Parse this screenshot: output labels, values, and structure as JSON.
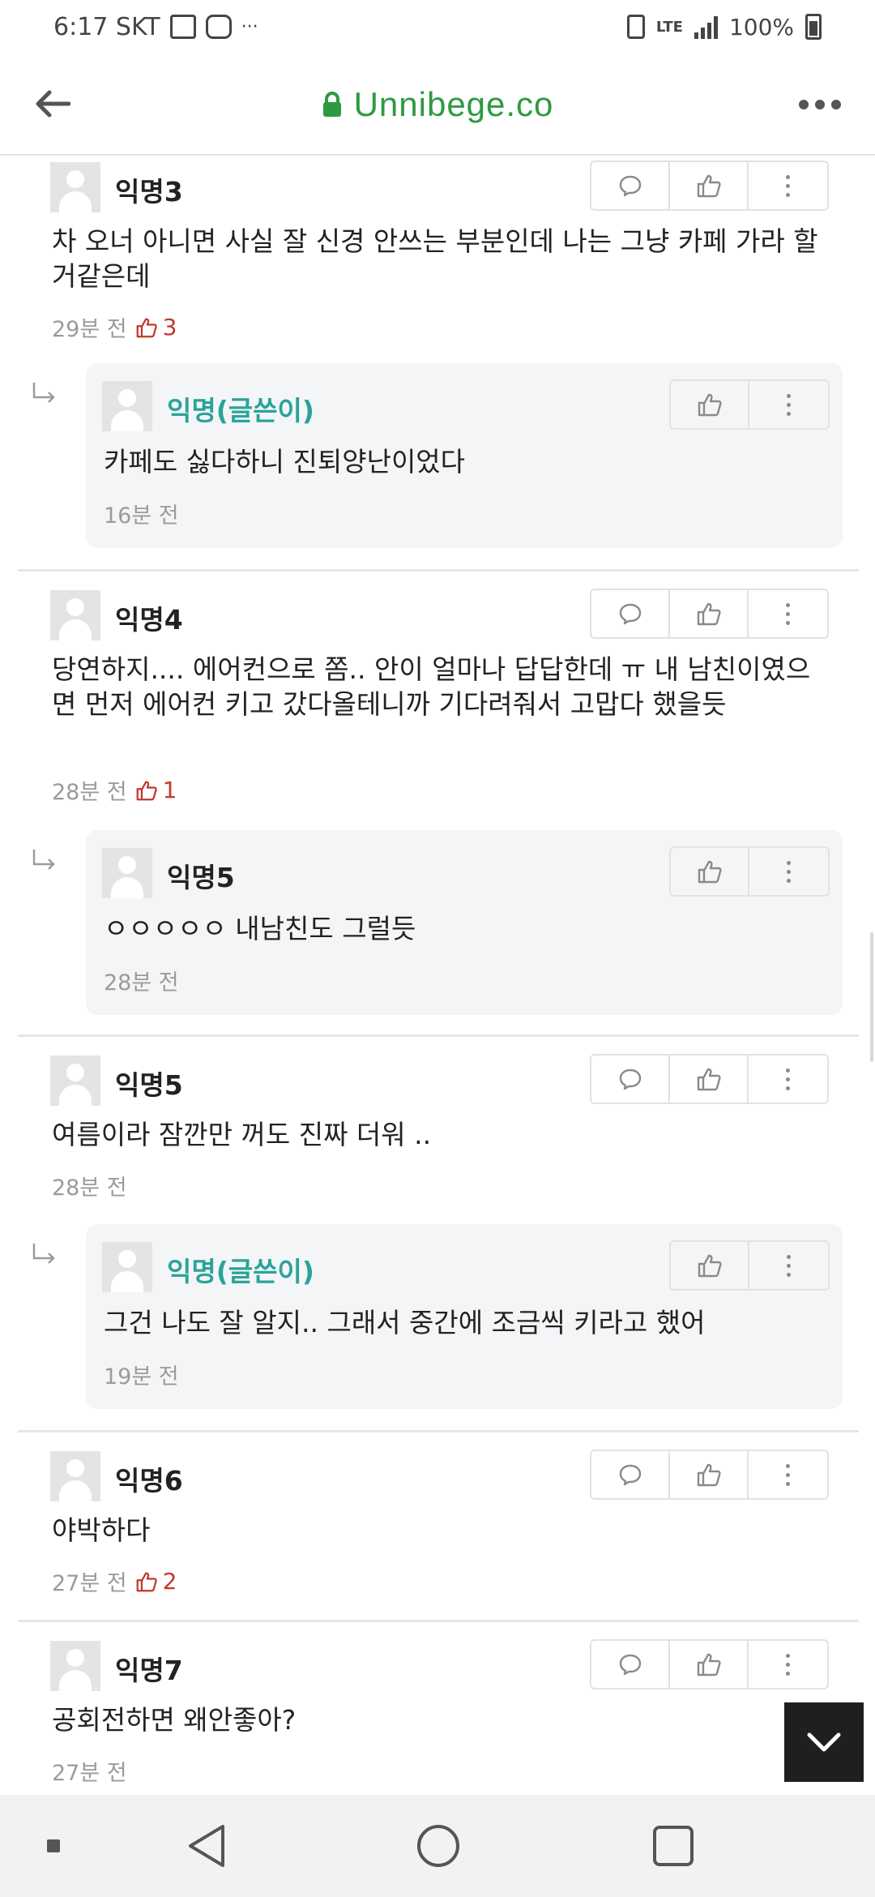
{
  "status_bar": {
    "time_carrier": "6:17 SKT",
    "more_indicator": "···",
    "lte": "LTE",
    "battery": "100%"
  },
  "browser": {
    "url": "Unnibege.co",
    "back_icon": "arrow-left-icon",
    "lock_icon": "lock-icon",
    "menu_icon": "more-horizontal-icon"
  },
  "comments": [
    {
      "nick": "익명3",
      "text": "차 오너 아니면 사실 잘 신경 안쓰는 부분인데 나는 그냥 카페 가라 할거같은데",
      "time": "29분 전",
      "likes": "3",
      "replies": [
        {
          "nick": "익명(글쓴이)",
          "text": "카페도 싫다하니 진퇴양난이었다",
          "time": "16분 전"
        }
      ]
    },
    {
      "nick": "익명4",
      "text": "당연하지.... 에어컨으로 쫌.. 안이 얼마나 답답한데 ㅠ 내 남친이였으면 먼저 에어컨 키고 갔다올테니까 기다려줘서 고맙다 했을듯",
      "time": "28분 전",
      "likes": "1",
      "replies": [
        {
          "nick": "익명5",
          "text": "ㅇㅇㅇㅇㅇ 내남친도 그럴듯",
          "time": "28분 전"
        }
      ]
    },
    {
      "nick": "익명5",
      "text": "여름이라 잠깐만 꺼도 진짜 더워 ..",
      "time": "28분 전",
      "likes": "",
      "replies": [
        {
          "nick": "익명(글쓴이)",
          "text": "그건 나도 잘 알지.. 그래서 중간에 조금씩 키라고 했어",
          "time": "19분 전"
        }
      ]
    },
    {
      "nick": "익명6",
      "text": "야박하다",
      "time": "27분 전",
      "likes": "2",
      "replies": []
    },
    {
      "nick": "익명7",
      "text": "공회전하면 왜안좋아?",
      "time": "27분 전",
      "likes": "",
      "replies": []
    }
  ],
  "colors": {
    "url_green": "#2e9a3f",
    "op_teal": "#2ba39a",
    "like_red": "#c0392b",
    "reply_bg": "#f4f5f7"
  }
}
